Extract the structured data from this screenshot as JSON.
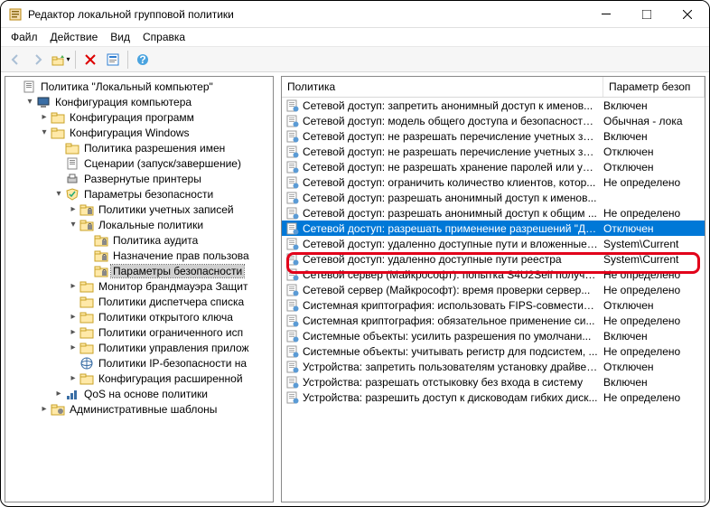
{
  "title": "Редактор локальной групповой политики",
  "menu": {
    "file": "Файл",
    "action": "Действие",
    "view": "Вид",
    "help": "Справка"
  },
  "tree": {
    "root_label": "Политика \"Локальный компьютер\"",
    "n1": "Конфигурация компьютера",
    "n1_1": "Конфигурация программ",
    "n1_2": "Конфигурация Windows",
    "n1_2_1": "Политика разрешения имен",
    "n1_2_2": "Сценарии (запуск/завершение)",
    "n1_2_3": "Развернутые принтеры",
    "n1_2_4": "Параметры безопасности",
    "n1_2_4_1": "Политики учетных записей",
    "n1_2_4_2": "Локальные политики",
    "n1_2_4_2_1": "Политика аудита",
    "n1_2_4_2_2": "Назначение прав пользова",
    "n1_2_4_2_3": "Параметры безопасности",
    "n1_2_4_3": "Монитор брандмауэра Защит",
    "n1_2_4_4": "Политики диспетчера списка",
    "n1_2_4_5": "Политики открытого ключа",
    "n1_2_4_6": "Политики ограниченного исп",
    "n1_2_4_7": "Политики управления прилож",
    "n1_2_4_8": "Политики IP-безопасности на",
    "n1_2_4_9": "Конфигурация расширенной",
    "n1_2_5": "QoS на основе политики",
    "n1_3": "Административные шаблоны"
  },
  "columns": {
    "policy": "Политика",
    "value": "Параметр безоп"
  },
  "policies": [
    {
      "name": "Сетевой доступ: запретить анонимный доступ к именов...",
      "value": "Включен"
    },
    {
      "name": "Сетевой доступ: модель общего доступа и безопасности ...",
      "value": "Обычная - лока"
    },
    {
      "name": "Сетевой доступ: не разрешать перечисление учетных за...",
      "value": "Включен"
    },
    {
      "name": "Сетевой доступ: не разрешать перечисление учетных за...",
      "value": "Отключен"
    },
    {
      "name": "Сетевой доступ: не разрешать хранение паролей или уче...",
      "value": "Отключен"
    },
    {
      "name": "Сетевой доступ: ограничить количество клиентов, котор...",
      "value": "Не определено"
    },
    {
      "name": "Сетевой доступ: разрешать анонимный доступ к именов...",
      "value": ""
    },
    {
      "name": "Сетевой доступ: разрешать анонимный доступ к общим ...",
      "value": "Не определено"
    },
    {
      "name": "Сетевой доступ: разрешать применение разрешений \"Дл...",
      "value": "Отключен",
      "selected": true
    },
    {
      "name": "Сетевой доступ: удаленно доступные пути и вложенные ...",
      "value": "System\\Current"
    },
    {
      "name": "Сетевой доступ: удаленно доступные пути реестра",
      "value": "System\\Current"
    },
    {
      "name": "Сетевой сервер (Майкрософт): попытка S4U2Self получи...",
      "value": "Не определено"
    },
    {
      "name": "Сетевой сервер (Майкрософт): время проверки сервер...",
      "value": "Не определено"
    },
    {
      "name": "Системная криптография: использовать FIPS-совместим...",
      "value": "Отключен"
    },
    {
      "name": "Системная криптография: обязательное применение си...",
      "value": "Не определено"
    },
    {
      "name": "Системные объекты: усилить разрешения по умолчани...",
      "value": "Включен"
    },
    {
      "name": "Системные объекты: учитывать регистр для подсистем, ...",
      "value": "Не определено"
    },
    {
      "name": "Устройства: запретить пользователям установку драйвер...",
      "value": "Отключен"
    },
    {
      "name": "Устройства: разрешать отстыковку без входа в систему",
      "value": "Включен"
    },
    {
      "name": "Устройства: разрешить доступ к дисководам гибких диск...",
      "value": "Не определено"
    }
  ]
}
